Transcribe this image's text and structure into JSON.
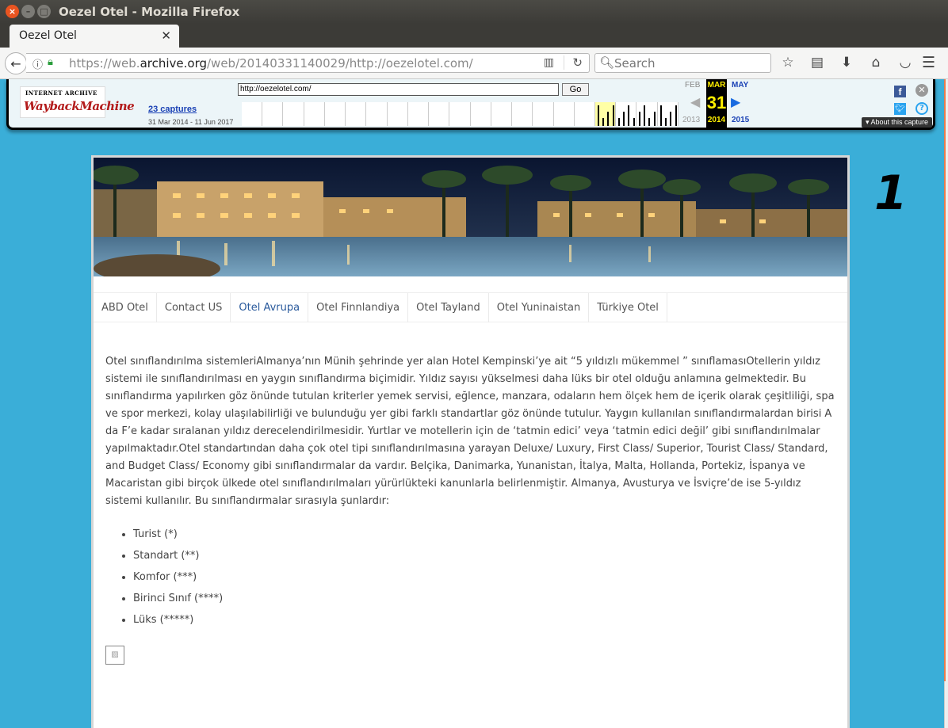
{
  "window": {
    "title": "Oezel Otel - Mozilla Firefox"
  },
  "tab": {
    "title": "Oezel Otel"
  },
  "navbar": {
    "url_prefix": "https://web.",
    "url_domain": "archive.org",
    "url_suffix": "/web/20140331140029/http://oezelotel.com/",
    "search_placeholder": "Search"
  },
  "wayback": {
    "logo_top": "INTERNET ARCHIVE",
    "logo_main": "WaybackMachine",
    "url_value": "http://oezelotel.com/",
    "go_label": "Go",
    "captures_link": "23 captures",
    "capture_range": "31 Mar 2014 - 11 Jun 2017",
    "prev_month": "FEB",
    "cur_month": "MAR",
    "cur_day": "31",
    "next_month": "MAY",
    "prev_year": "2013",
    "cur_year": "2014",
    "next_year": "2015",
    "about_label": "▾ About this capture",
    "sparkline_years": [
      0,
      0,
      0,
      0,
      0,
      0,
      0,
      0,
      0,
      0,
      0,
      0,
      0,
      0,
      0,
      0,
      0,
      1,
      1,
      1,
      1
    ]
  },
  "menu": {
    "items": [
      "ABD Otel",
      "Contact US",
      "Otel Avrupa",
      "Otel Finnlandiya",
      "Otel Tayland",
      "Otel Yuninaistan",
      "Türkiye Otel"
    ],
    "active_index": 2
  },
  "content": {
    "paragraph": "Otel sınıflandırılma sistemleriAlmanya’nın Münih şehrinde yer alan Hotel Kempinski’ye ait “5 yıldızlı mükemmel ” sınıflamasıOtellerin yıldız sistemi ile sınıflandırılması en yaygın sınıflandırma biçimidir. Yıldız sayısı yükselmesi daha lüks bir otel olduğu anlamına gelmektedir. Bu sınıflandırma yapılırken göz önünde tutulan kriterler yemek servisi, eğlence, manzara, odaların hem ölçek hem de içerik olarak çeşitliliği, spa ve spor merkezi, kolay ulaşılabilirliği ve bulunduğu yer gibi farklı standartlar göz önünde tutulur. Yaygın kullanılan sınıflandırmalardan birisi A da F’e kadar sıralanan yıldız derecelendirilmesidir. Yurtlar ve motellerin için de ‘tatmin edici’ veya ‘tatmin edici değil’ gibi sınıflandırılmalar yapılmaktadır.Otel standartından daha çok otel tipi sınıflandırılmasına yarayan Deluxe/ Luxury, First Class/ Superior, Tourist Class/ Standard, and Budget Class/ Economy gibi sınıflandırmalar da vardır. Belçika, Danimarka, Yunanistan, İtalya, Malta, Hollanda, Portekiz, İspanya ve Macaristan gibi birçok ülkede otel sınıflandırılmaları yürürlükteki kanunlarla belirlenmiştir. Almanya, Avusturya ve İsviçre’de ise 5-yıldız sistemi kullanılır. Bu sınıflandırmalar sırasıyla şunlardır:",
    "list": [
      "Turist (*)",
      "Standart (**)",
      "Komfor (***)",
      "Birinci Sınıf (****)",
      "Lüks (*****)"
    ]
  },
  "side_number": "1",
  "colors": {
    "page_bg": "#3aaed8",
    "active_menu": "#2a5a9c",
    "wayback_red": "#b31b1b",
    "wayback_yellow": "#ffef00"
  }
}
